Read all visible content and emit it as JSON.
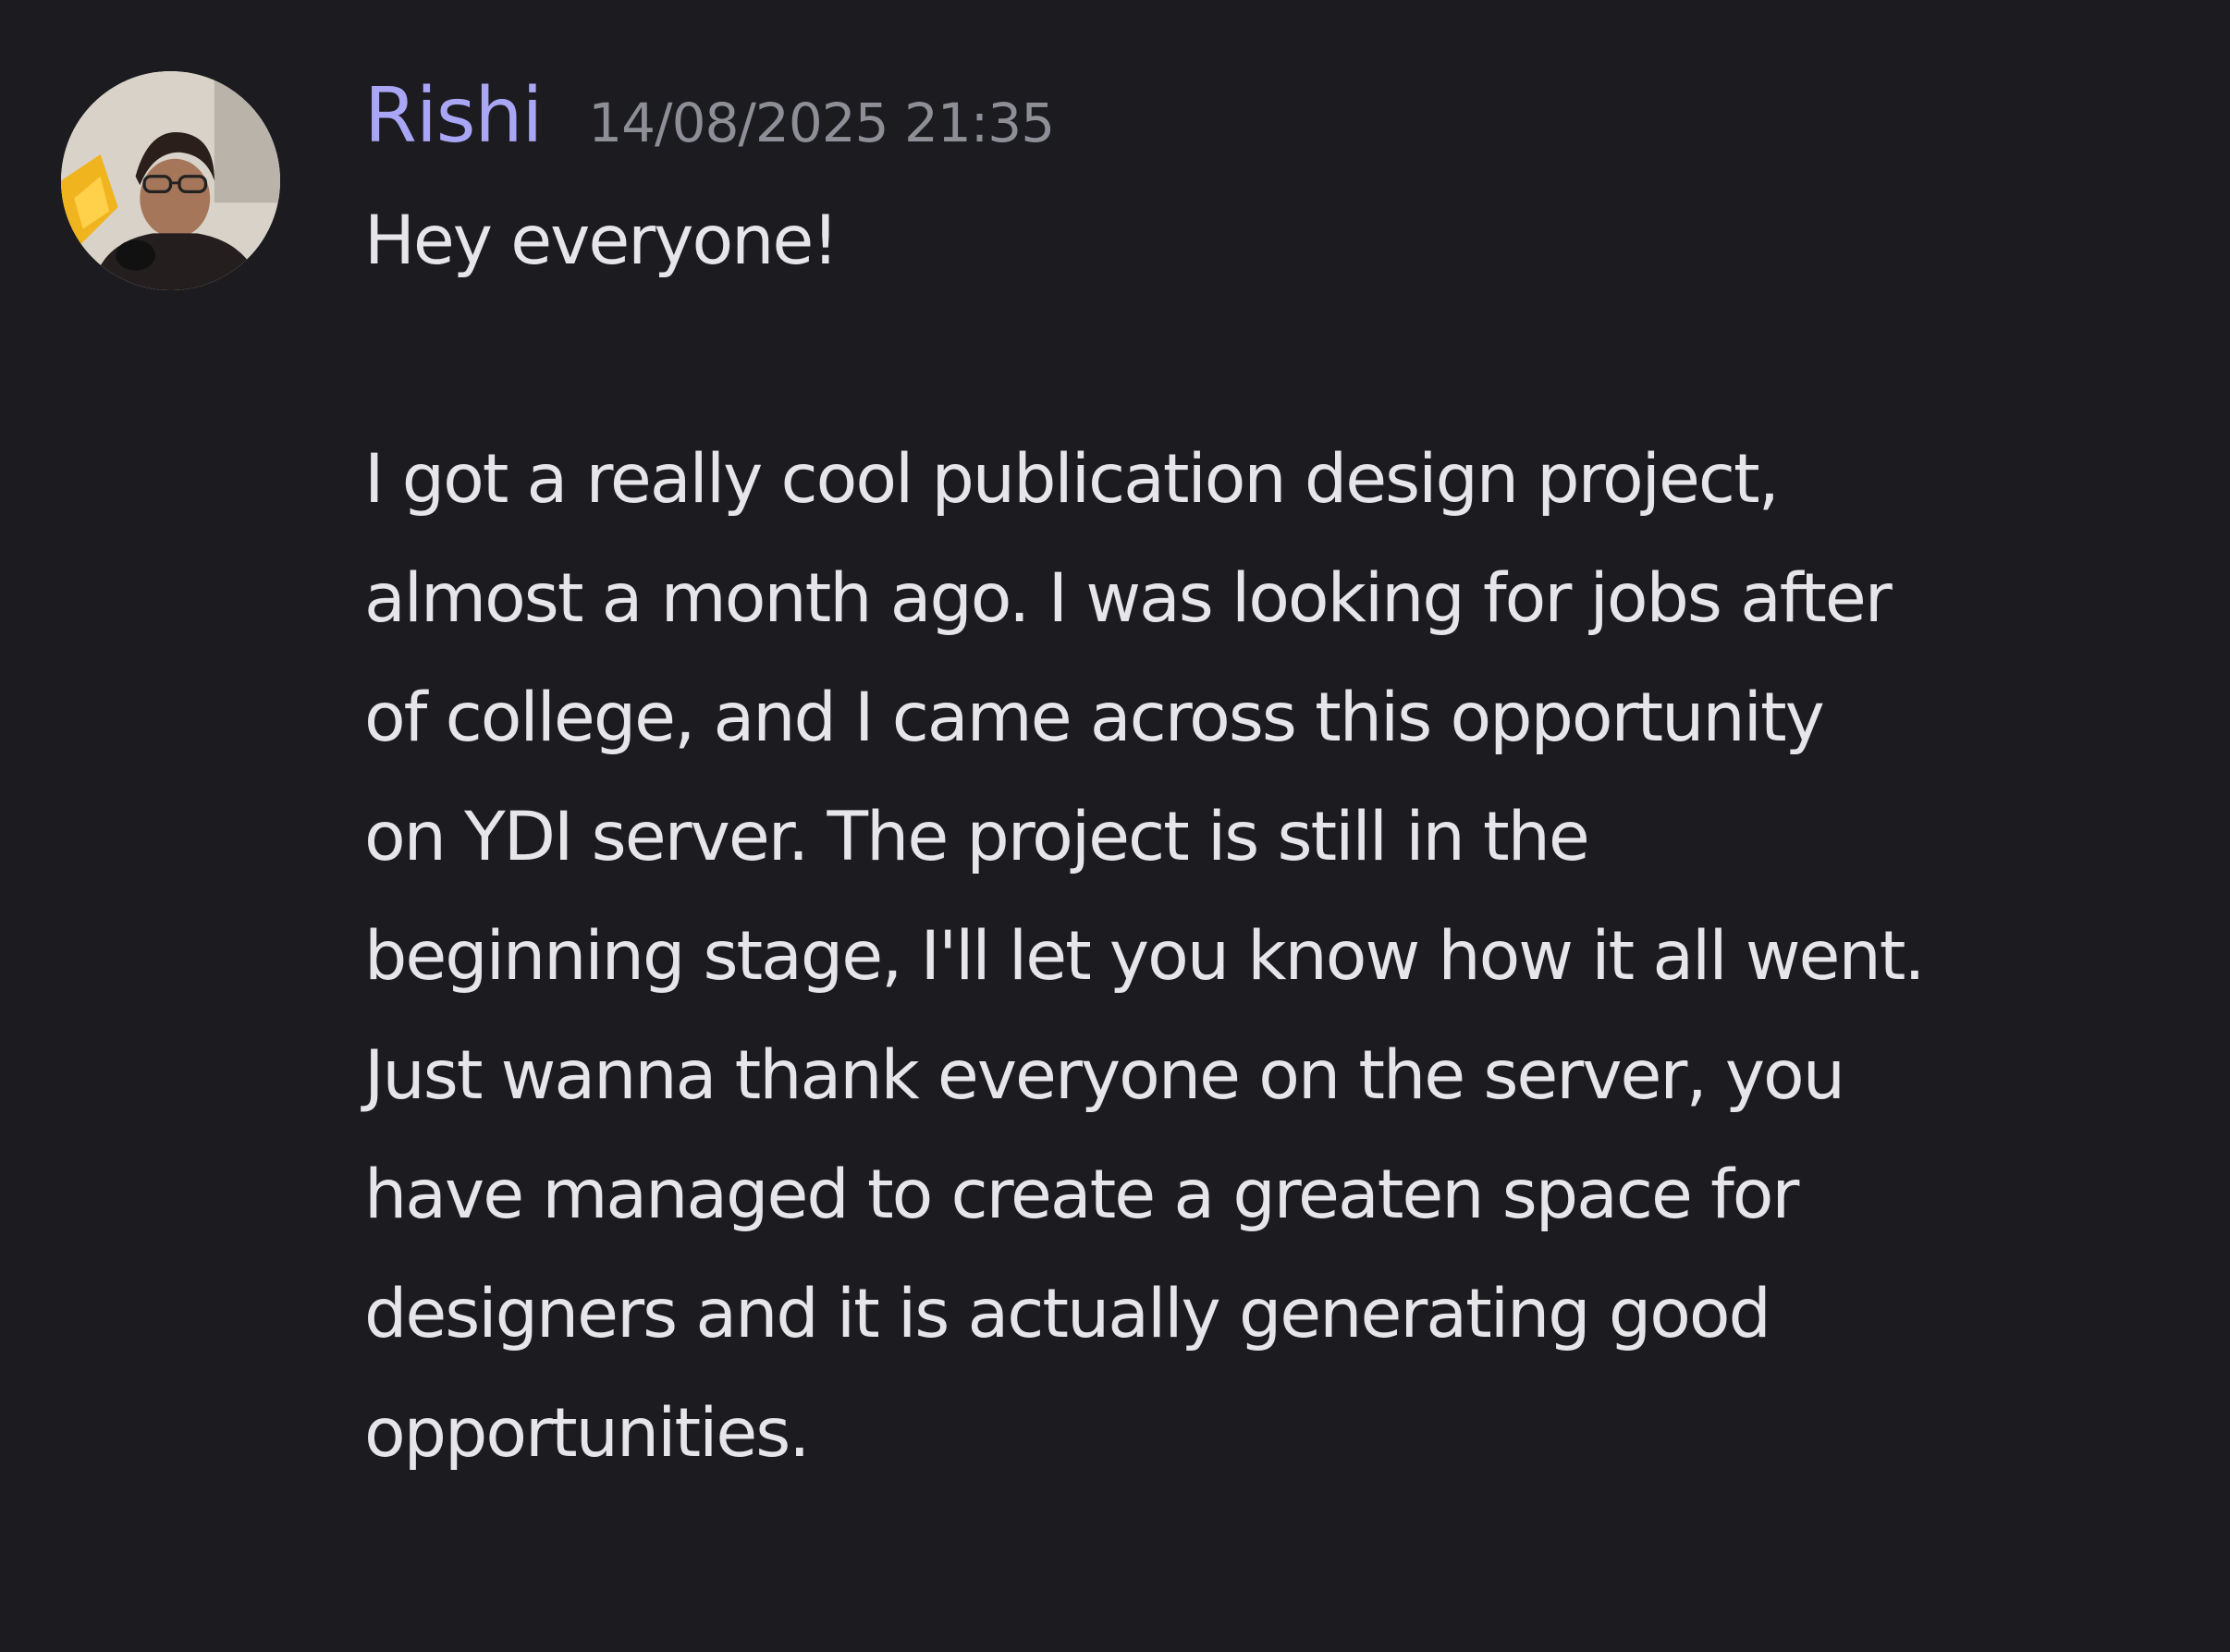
{
  "message": {
    "author": "Rishi",
    "timestamp": "14/08/2025 21:35",
    "greeting": "Hey everyone!",
    "body_lines": [
      "I got a really cool publication design project,",
      "almost a month ago. I was looking for jobs after",
      "of college, and I came across this opportunity",
      "on YDI server. The project is still in the",
      "beginning stage, I'll let you know how it all went.",
      "Just wanna thank everyone on the server, you",
      "have managed to create a greaten space for",
      "designers and it is actually generating good",
      "opportunities."
    ]
  },
  "colors": {
    "background": "#1b1b20",
    "username": "#a9a6f5",
    "timestamp": "#8e8f96",
    "text": "#e6e6e9"
  }
}
